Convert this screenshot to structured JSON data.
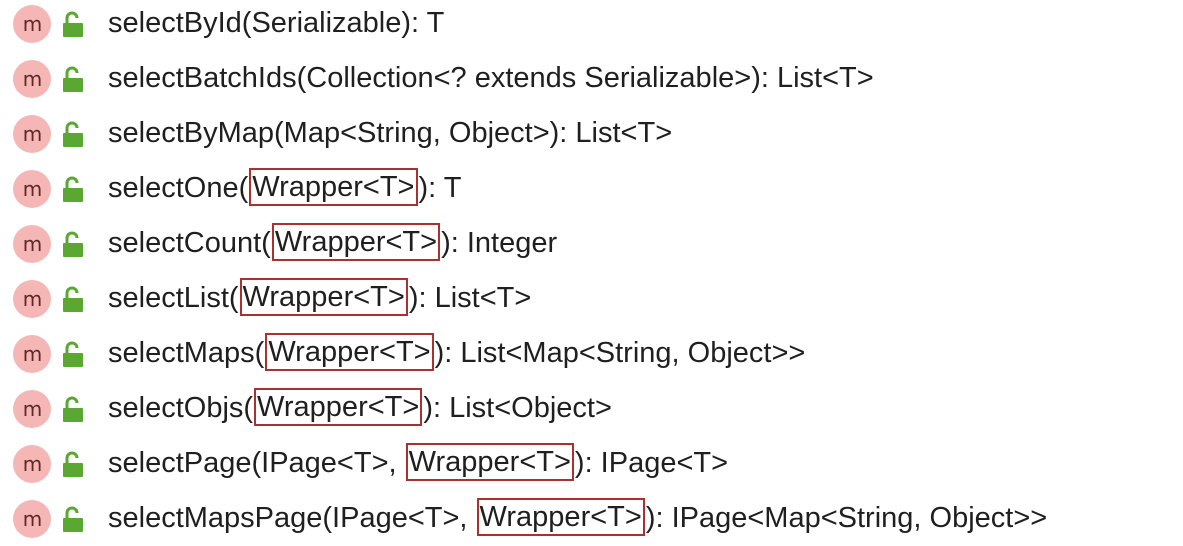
{
  "methods": [
    {
      "name": "selectById",
      "before": "selectById(Serializable): T",
      "boxed": "",
      "after": ""
    },
    {
      "name": "selectBatchIds",
      "before": "selectBatchIds(Collection<? extends Serializable>): List<T>",
      "boxed": "",
      "after": ""
    },
    {
      "name": "selectByMap",
      "before": "selectByMap(Map<String, Object>): List<T>",
      "boxed": "",
      "after": ""
    },
    {
      "name": "selectOne",
      "before": "selectOne(",
      "boxed": "Wrapper<T>",
      "after": "): T"
    },
    {
      "name": "selectCount",
      "before": "selectCount(",
      "boxed": "Wrapper<T>",
      "after": "): Integer"
    },
    {
      "name": "selectList",
      "before": "selectList(",
      "boxed": "Wrapper<T>",
      "after": "): List<T>"
    },
    {
      "name": "selectMaps",
      "before": "selectMaps(",
      "boxed": "Wrapper<T>",
      "after": "): List<Map<String, Object>>"
    },
    {
      "name": "selectObjs",
      "before": "selectObjs(",
      "boxed": "Wrapper<T>",
      "after": "): List<Object>"
    },
    {
      "name": "selectPage",
      "before": "selectPage(IPage<T>, ",
      "boxed": "Wrapper<T>",
      "after": "): IPage<T>"
    },
    {
      "name": "selectMapsPage",
      "before": "selectMapsPage(IPage<T>, ",
      "boxed": "Wrapper<T>",
      "after": "): IPage<Map<String, Object>>"
    }
  ],
  "icons": {
    "method_icon": "method-m-icon",
    "method_icon_letter": "m",
    "access_icon": "public-unlock-icon"
  },
  "colors": {
    "method_icon_bg": "#f5b6b6",
    "lock_green": "#5aa832",
    "highlight_border": "#a83232",
    "text": "#1f1f1f"
  }
}
